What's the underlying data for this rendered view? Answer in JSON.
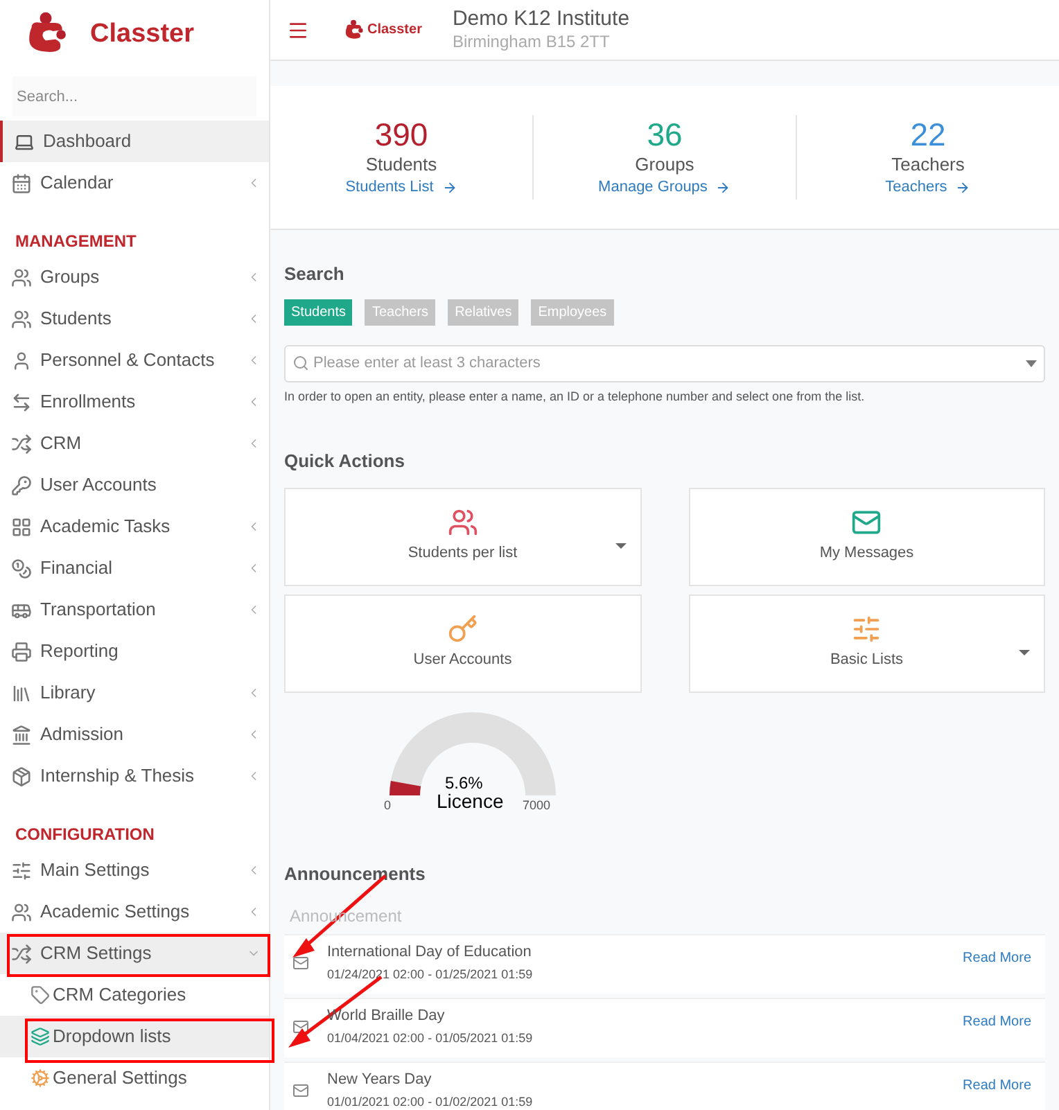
{
  "sidebar": {
    "brand": "Classter",
    "search": {
      "placeholder": "Search..."
    },
    "items": [
      {
        "kind": "item",
        "label": "Dashboard",
        "selected": true,
        "expandable": false
      },
      {
        "kind": "item",
        "label": "Calendar",
        "selected": false,
        "expandable": true
      },
      {
        "kind": "section",
        "label": "MANAGEMENT"
      },
      {
        "kind": "item",
        "label": "Groups",
        "selected": false,
        "expandable": true
      },
      {
        "kind": "item",
        "label": "Students",
        "selected": false,
        "expandable": true
      },
      {
        "kind": "item",
        "label": "Personnel & Contacts",
        "selected": false,
        "expandable": true
      },
      {
        "kind": "item",
        "label": "Enrollments",
        "selected": false,
        "expandable": true
      },
      {
        "kind": "item",
        "label": "CRM",
        "selected": false,
        "expandable": true
      },
      {
        "kind": "item",
        "label": "User Accounts",
        "selected": false,
        "expandable": false
      },
      {
        "kind": "item",
        "label": "Academic Tasks",
        "selected": false,
        "expandable": true
      },
      {
        "kind": "item",
        "label": "Financial",
        "selected": false,
        "expandable": true
      },
      {
        "kind": "item",
        "label": "Transportation",
        "selected": false,
        "expandable": true
      },
      {
        "kind": "item",
        "label": "Reporting",
        "selected": false,
        "expandable": false
      },
      {
        "kind": "item",
        "label": "Library",
        "selected": false,
        "expandable": true
      },
      {
        "kind": "item",
        "label": "Admission",
        "selected": false,
        "expandable": true
      },
      {
        "kind": "item",
        "label": "Internship & Thesis",
        "selected": false,
        "expandable": true
      },
      {
        "kind": "section",
        "label": "CONFIGURATION"
      },
      {
        "kind": "item",
        "label": "Main Settings",
        "selected": false,
        "expandable": true
      },
      {
        "kind": "item",
        "label": "Academic Settings",
        "selected": false,
        "expandable": true
      },
      {
        "kind": "item",
        "label": "CRM Settings",
        "selected": false,
        "expandable": true,
        "expanded": true,
        "children": [
          {
            "label": "CRM Categories",
            "selected": false
          },
          {
            "label": "Dropdown lists",
            "selected": true
          },
          {
            "label": "General Settings",
            "selected": false
          }
        ]
      }
    ]
  },
  "header": {
    "brand": "Classter",
    "title": "Demo K12 Institute",
    "subtitle": "Birmingham B15 2TT"
  },
  "stats": [
    {
      "value": "390",
      "label": "Students",
      "link": "Students List",
      "color": "#b5202e"
    },
    {
      "value": "36",
      "label": "Groups",
      "link": "Manage Groups",
      "color": "#1fa88a"
    },
    {
      "value": "22",
      "label": "Teachers",
      "link": "Teachers",
      "color": "#3b8fd8"
    }
  ],
  "search": {
    "title": "Search",
    "tabs": [
      {
        "label": "Students",
        "selected": true
      },
      {
        "label": "Teachers",
        "selected": false
      },
      {
        "label": "Relatives",
        "selected": false
      },
      {
        "label": "Employees",
        "selected": false
      }
    ],
    "placeholder": "Please enter at least 3 characters",
    "help": "In order to open an entity, please enter a name, an ID or a telephone number and select one from the list."
  },
  "quick_actions": {
    "title": "Quick Actions",
    "items": [
      {
        "label": "Students per list",
        "dropdown": true
      },
      {
        "label": "My Messages",
        "dropdown": false
      },
      {
        "label": "User Accounts",
        "dropdown": false
      },
      {
        "label": "Basic Lists",
        "dropdown": true
      }
    ]
  },
  "licence_gauge": {
    "level": 0.056,
    "reading": "5.6%",
    "label": "Licence",
    "min": "0",
    "max": "7000"
  },
  "announcements": {
    "title": "Announcements",
    "column": "Announcement",
    "items": [
      {
        "title": "International Day of Education",
        "dates": "01/24/2021 02:00 - 01/25/2021 01:59",
        "link": "Read More"
      },
      {
        "title": "World Braille Day",
        "dates": "01/04/2021 02:00 - 01/05/2021 01:59",
        "link": "Read More"
      },
      {
        "title": "New Years Day",
        "dates": "01/01/2021 02:00 - 01/02/2021 01:59",
        "link": "Read More"
      }
    ]
  }
}
